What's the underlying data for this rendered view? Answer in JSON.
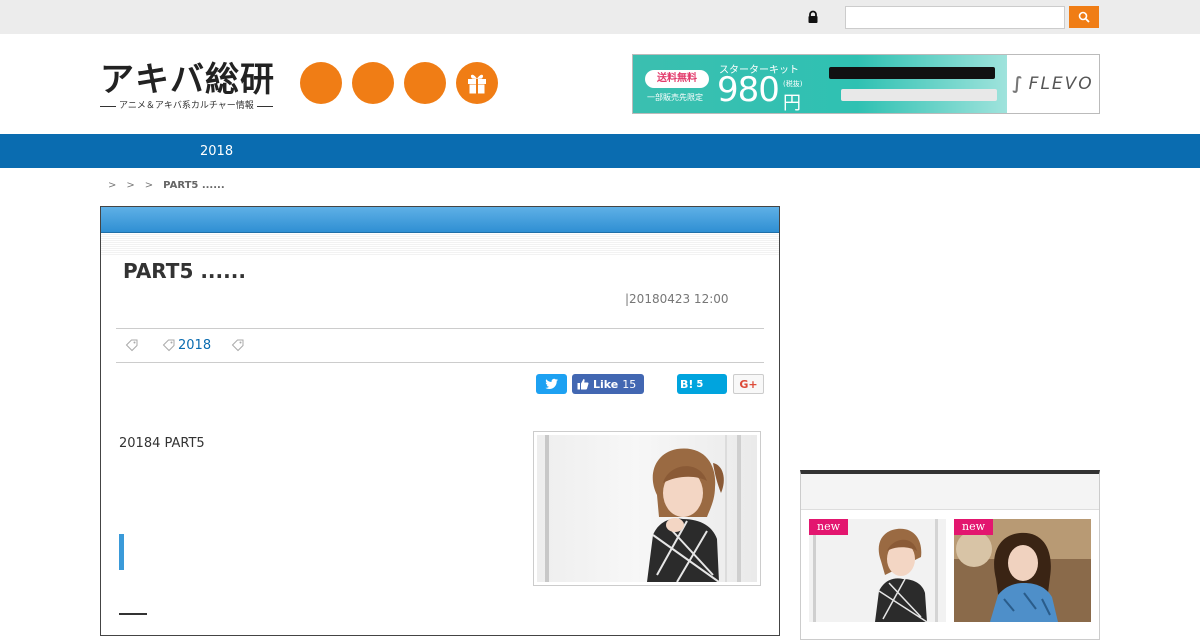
{
  "topbar": {
    "search_placeholder": "",
    "lock_icon": "lock-icon",
    "search_icon": "search-icon"
  },
  "header": {
    "logo_main": "アキバ総研",
    "logo_sub": "アニメ＆アキバ系カルチャー情報",
    "social_icons": [
      "orange-circle-icon",
      "orange-circle-icon",
      "orange-circle-icon",
      "gift-icon"
    ],
    "accent_color": "#f07d15"
  },
  "ad": {
    "pill": "送料無料",
    "sub": "一部販売先限定",
    "kit": "スターターキット",
    "price": "980",
    "tax": "(税抜)",
    "yen": "円",
    "brand": "FLEVO"
  },
  "nav": {
    "items": [
      {
        "label": "2018"
      }
    ],
    "color": "#0a6cb0"
  },
  "breadcrumb": {
    "separators": [
      ">",
      ">",
      ">"
    ],
    "current": "PART5 ......"
  },
  "article": {
    "title": "PART5 ......",
    "date": "|20180423 12:00",
    "tag": "2018",
    "share": {
      "like_label": "Like",
      "like_count": "15",
      "hatena_label": "B!",
      "hatena_count": "5",
      "gplus_label": "G+"
    },
    "body": "20184 PART5"
  },
  "sidebar": {
    "title": "",
    "badges": [
      "new",
      "new"
    ]
  }
}
